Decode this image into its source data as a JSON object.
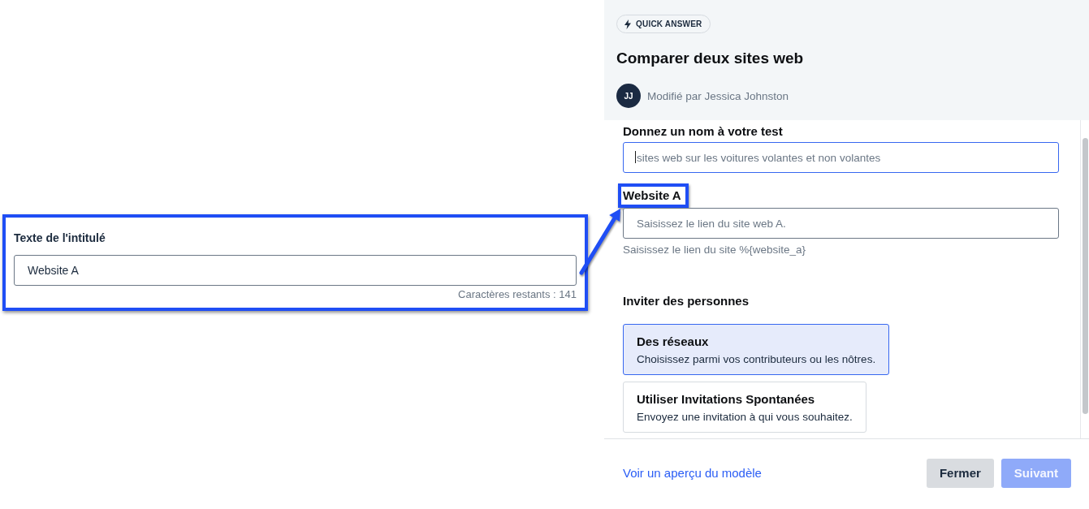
{
  "callout": {
    "label": "Texte de l'intitulé",
    "value": "Website A",
    "counter": "Caractères restants : 141"
  },
  "panel": {
    "badge": "QUICK ANSWER",
    "title": "Comparer deux sites web",
    "avatar": "JJ",
    "modified_by": "Modifié par Jessica Johnston"
  },
  "form": {
    "fields": [
      {
        "label": "Donnez un nom à votre test",
        "placeholder": "sites web sur les voitures volantes et non volantes",
        "focused": true,
        "highlighted": false
      },
      {
        "label": "Website A",
        "placeholder": "Saisissez le lien du site web A.",
        "help": "Saisissez le lien du site %{website_a}",
        "focused": false,
        "highlighted": true
      }
    ],
    "invite": {
      "heading": "Inviter des personnes",
      "options": [
        {
          "title": "Des réseaux",
          "description": "Choisissez parmi vos contributeurs ou les nôtres.",
          "selected": true
        },
        {
          "title": "Utiliser Invitations Spontanées",
          "description": "Envoyez une invitation à qui vous souhaitez.",
          "selected": false
        }
      ]
    }
  },
  "footer": {
    "link": "Voir un aperçu du modèle",
    "buttons": [
      {
        "label": "Fermer",
        "kind": "secondary",
        "disabled": false
      },
      {
        "label": "Suivant",
        "kind": "primary",
        "disabled": true
      }
    ]
  }
}
